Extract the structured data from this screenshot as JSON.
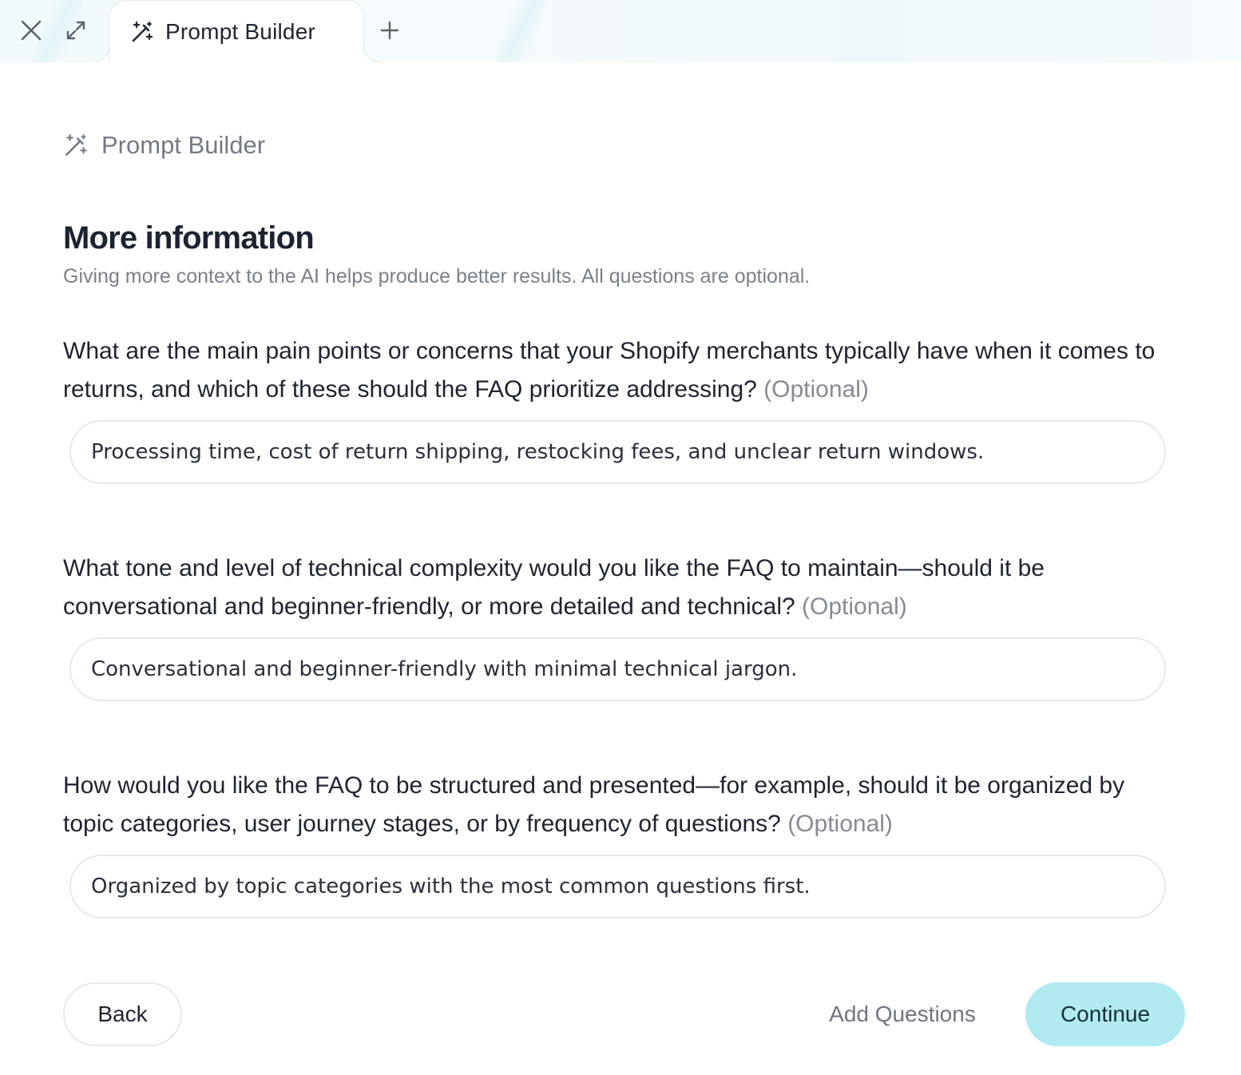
{
  "topbar": {
    "tab_label": "Prompt Builder",
    "icons": {
      "close": "close-icon",
      "expand": "expand-icon",
      "tab": "magic-wand-icon",
      "new_tab": "plus-icon"
    }
  },
  "page": {
    "crumb_label": "Prompt Builder",
    "title": "More information",
    "subtitle": "Giving more context to the AI helps produce better results. All questions are optional."
  },
  "questions": [
    {
      "text": "What are the main pain points or concerns that your Shopify merchants typically have when it comes to returns, and which of these should the FAQ prioritize addressing?",
      "optional_label": "(Optional)",
      "answer": "Processing time, cost of return shipping, restocking fees, and unclear return windows."
    },
    {
      "text": "What tone and level of technical complexity would you like the FAQ to maintain—should it be conversational and beginner-friendly, or more detailed and technical?",
      "optional_label": "(Optional)",
      "answer": "Conversational and beginner-friendly with minimal technical jargon."
    },
    {
      "text": "How would you like the FAQ to be structured and presented—for example, should it be organized by topic categories, user journey stages, or by frequency of questions?",
      "optional_label": "(Optional)",
      "answer": "Organized by topic categories with the most common questions first."
    }
  ],
  "footer": {
    "back_label": "Back",
    "add_questions_label": "Add Questions",
    "continue_label": "Continue"
  },
  "colors": {
    "accent": "#b1ebf1",
    "text": "#1e2330",
    "muted": "#7a808a"
  }
}
